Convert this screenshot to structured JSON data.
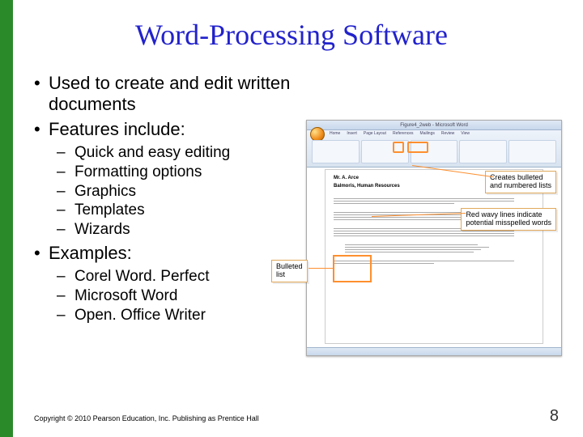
{
  "title": "Word-Processing Software",
  "bullets": {
    "b1": "Used to create and edit written documents",
    "b2": "Features include:",
    "b2_subs": {
      "s1": "Quick and easy editing",
      "s2": "Formatting options",
      "s3": "Graphics",
      "s4": "Templates",
      "s5": "Wizards"
    },
    "b3": "Examples:",
    "b3_subs": {
      "s1": "Corel Word. Perfect",
      "s2": "Microsoft Word",
      "s3": "Open. Office Writer"
    }
  },
  "screenshot": {
    "title": "Figure4_2web - Microsoft Word",
    "tabs": [
      "Home",
      "Insert",
      "Page Layout",
      "References",
      "Mailings",
      "Review",
      "View"
    ],
    "callout1_l1": "Creates bulleted",
    "callout1_l2": "and numbered lists",
    "callout2_l1": "Red wavy lines indicate",
    "callout2_l2": "potential misspelled words",
    "callout3_l1": "Bulleted",
    "callout3_l2": "list",
    "doc_name_line1": "Mr. A. Arce",
    "doc_name_line2": "Balmoris, Human Resources"
  },
  "copyright": "Copyright © 2010 Pearson Education, Inc. Publishing as Prentice Hall",
  "page_number": "8"
}
